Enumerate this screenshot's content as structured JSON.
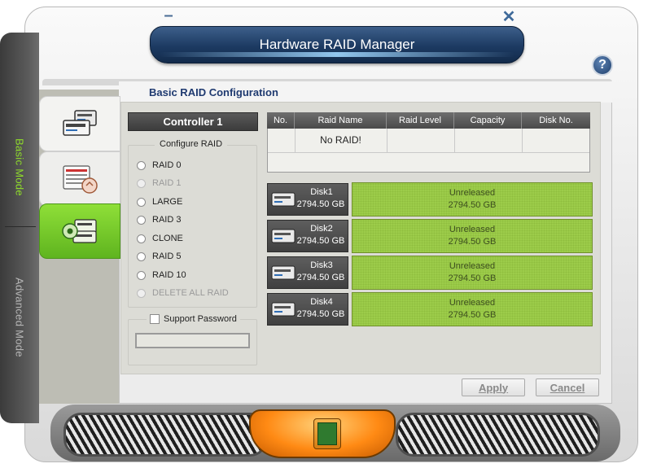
{
  "window": {
    "title": "Hardware RAID Manager",
    "minimize_glyph": "–",
    "close_glyph": "✕",
    "help_glyph": "?"
  },
  "side_tabs": {
    "basic": "Basic Mode",
    "advanced": "Advanced Mode"
  },
  "panel": {
    "title": "Basic RAID Configuration"
  },
  "controller": {
    "label": "Controller 1"
  },
  "configure_raid": {
    "label": "Configure RAID",
    "options": [
      {
        "label": "RAID 0",
        "enabled": true
      },
      {
        "label": "RAID 1",
        "enabled": false
      },
      {
        "label": "LARGE",
        "enabled": true
      },
      {
        "label": "RAID 3",
        "enabled": true
      },
      {
        "label": "CLONE",
        "enabled": true
      },
      {
        "label": "RAID 5",
        "enabled": true
      },
      {
        "label": "RAID 10",
        "enabled": true
      },
      {
        "label": "DELETE ALL RAID",
        "enabled": false
      }
    ]
  },
  "password": {
    "label": "Support Password",
    "checked": false,
    "value": ""
  },
  "table": {
    "headers": [
      "No.",
      "Raid Name",
      "Raid Level",
      "Capacity",
      "Disk No."
    ],
    "empty_message": "No RAID!"
  },
  "disks": [
    {
      "name": "Disk1",
      "size": "2794.50 GB",
      "status": "Unreleased",
      "status_size": "2794.50 GB"
    },
    {
      "name": "Disk2",
      "size": "2794.50 GB",
      "status": "Unreleased",
      "status_size": "2794.50 GB"
    },
    {
      "name": "Disk3",
      "size": "2794.50 GB",
      "status": "Unreleased",
      "status_size": "2794.50 GB"
    },
    {
      "name": "Disk4",
      "size": "2794.50 GB",
      "status": "Unreleased",
      "status_size": "2794.50 GB"
    }
  ],
  "buttons": {
    "apply": "Apply",
    "cancel": "Cancel"
  },
  "colors": {
    "accent_green": "#8fdc2a",
    "title_blue": "#1c3a62",
    "disk_status_green": "#9ccc4a"
  },
  "icons": {
    "nav1": "raid-array-icon",
    "nav2": "raid-settings-icon",
    "nav3": "raid-config-gear-icon",
    "disk": "hard-disk-icon",
    "help": "help-icon"
  }
}
